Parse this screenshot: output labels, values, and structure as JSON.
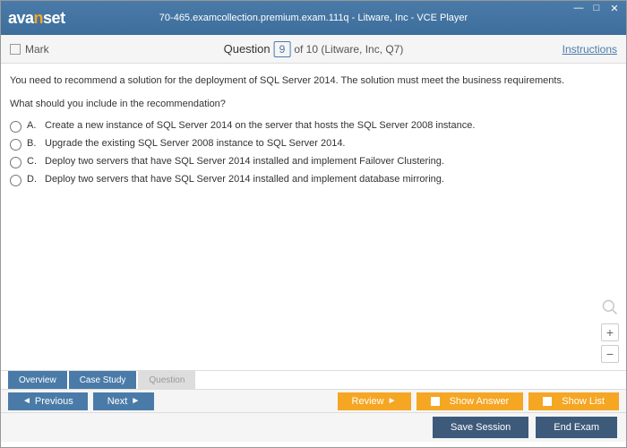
{
  "titlebar": {
    "logo_prefix": "ava",
    "logo_accent": "n",
    "logo_suffix": "set",
    "title": "70-465.examcollection.premium.exam.111q - Litware, Inc - VCE Player"
  },
  "questionbar": {
    "mark_label": "Mark",
    "question_label": "Question",
    "question_num": "9",
    "question_of": "of 10 (Litware, Inc, Q7)",
    "instructions": "Instructions"
  },
  "content": {
    "question_text": "You need to recommend a solution for the deployment of SQL Server 2014. The solution must meet the business requirements.",
    "question_prompt": "What should you include in the recommendation?",
    "options": [
      {
        "letter": "A.",
        "text": "Create a new instance of SQL Server 2014 on the server that hosts the SQL Server 2008 instance."
      },
      {
        "letter": "B.",
        "text": "Upgrade the existing SQL Server 2008 instance to SQL Server 2014."
      },
      {
        "letter": "C.",
        "text": "Deploy two servers that have SQL Server 2014 installed and implement Failover Clustering."
      },
      {
        "letter": "D.",
        "text": "Deploy two servers that have SQL Server 2014 installed and implement database mirroring."
      }
    ]
  },
  "tabs": {
    "overview": "Overview",
    "case_study": "Case Study",
    "question": "Question"
  },
  "nav": {
    "previous": "Previous",
    "next": "Next",
    "review": "Review",
    "show_answer": "Show Answer",
    "show_list": "Show List"
  },
  "bottom": {
    "save_session": "Save Session",
    "end_exam": "End Exam"
  }
}
